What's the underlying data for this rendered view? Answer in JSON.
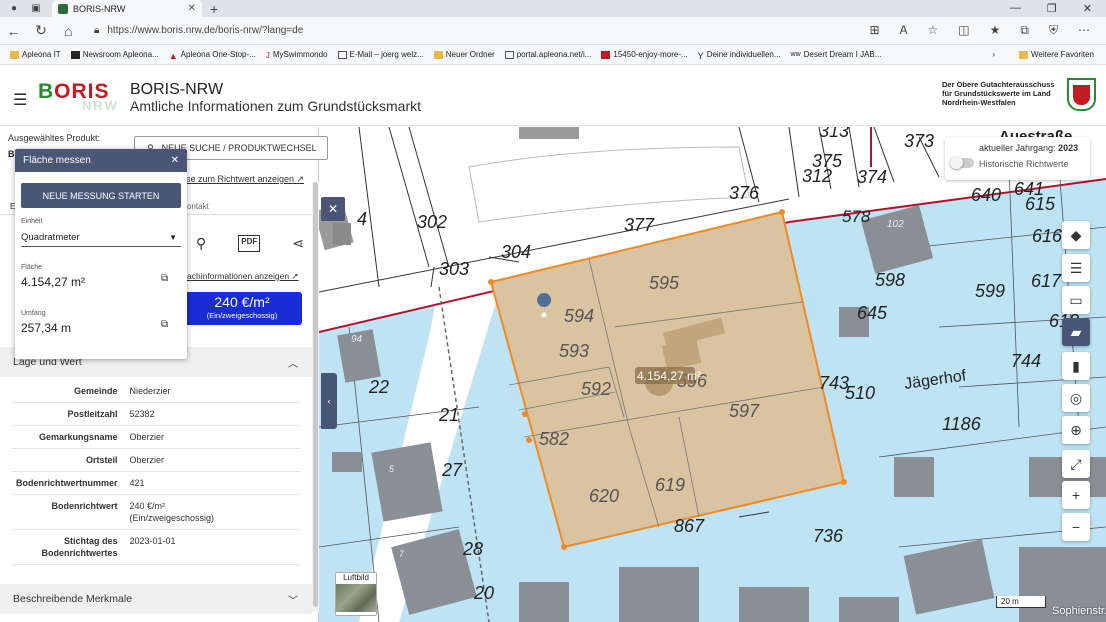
{
  "browser": {
    "tab_title": "BORIS-NRW",
    "url": "https://www.boris.nrw.de/boris-nrw/?lang=de",
    "bookmarks": [
      "Apleona IT",
      "Newsroom Apleona...",
      "Apleona One-Stop-...",
      "MySwimmondo",
      "E-Mail – joerg welz...",
      "Neuer Ordner",
      "portal.apleona.net/i...",
      "15450-enjoy-more-...",
      "Deine individuellen...",
      "Desert Dream I JAB..."
    ],
    "bookmarks_more": "Weitere Favoriten"
  },
  "header": {
    "logo_text": "BORIS",
    "logo_sub": "NRW",
    "title": "BORIS-NRW",
    "subtitle": "Amtliche Informationen zum Grundstücksmarkt",
    "org_line1": "Der Obere Gutachterausschuss",
    "org_line2": "für Grundstückswerte im Land",
    "org_line3": "Nordrhein-Westfalen"
  },
  "sidebar": {
    "selected_product_label": "Ausgewähltes Produkt:",
    "selected_product_value": "B",
    "new_search_label": "NEUE SUCHE / PRODUKTWECHSEL",
    "richtwert_link": "se zum Richtwert anzeigen ↗",
    "tab_e": "E",
    "tab_kontakt": "ontakt",
    "sachinfo_link": "achinformationen anzeigen ↗",
    "price_value": "240 €/m²",
    "price_sub": "(Ein/zweigeschossig)",
    "lage_header": "Lage und Wert",
    "merkmale_header": "Beschreibende Merkmale",
    "rows": [
      {
        "key": "Gemeinde",
        "value": "Niederzier"
      },
      {
        "key": "Postleitzahl",
        "value": "52382"
      },
      {
        "key": "Gemarkungsname",
        "value": "Oberzier"
      },
      {
        "key": "Ortsteil",
        "value": "Oberzier"
      },
      {
        "key": "Bodenrichtwertnummer",
        "value": "421"
      },
      {
        "key": "Bodenrichtwert",
        "value": "240 €/m²",
        "value2": "(Ein/zweigeschossig)"
      },
      {
        "key": "Stichtag des",
        "key2": "Bodenrichtwertes",
        "value": "2023-01-01"
      }
    ]
  },
  "measure": {
    "title": "Fläche messen",
    "new_button": "NEUE MESSUNG STARTEN",
    "unit_label": "Einheit",
    "unit_value": "Quadratmeter",
    "area_label": "Fläche",
    "area_value": "4.154,27 m²",
    "perimeter_label": "Umfang",
    "perimeter_value": "257,34 m"
  },
  "map": {
    "jahrgang_label": "aktueller Jahrgang:",
    "jahrgang_value": "2023",
    "historic_label": "Historische Richtwerte",
    "measure_label": "4.154,27 m²",
    "street_jaegerhof": "Jägerhof",
    "street_auestr": "Auestraße",
    "street_sophien": "Sophienstr.",
    "luftbild_label": "Luftbild",
    "scale_label": "20 m",
    "parcels": [
      "313",
      "373",
      "375",
      "312",
      "374",
      "376",
      "377",
      "302",
      "304",
      "303",
      "4",
      "595",
      "594",
      "593",
      "592",
      "596",
      "597",
      "582",
      "620",
      "619",
      "867",
      "736",
      "743",
      "510",
      "645",
      "1186",
      "744",
      "640",
      "641",
      "615",
      "616",
      "617",
      "598",
      "599",
      "618",
      "578",
      "102",
      "94",
      "22",
      "21",
      "27",
      "28",
      "20",
      "5",
      "7"
    ],
    "colors": {
      "parcel_blue": "#bde3f4",
      "selection": "#d9c3a0",
      "selection_border": "#f08a24",
      "red_line": "#b5122a"
    }
  }
}
